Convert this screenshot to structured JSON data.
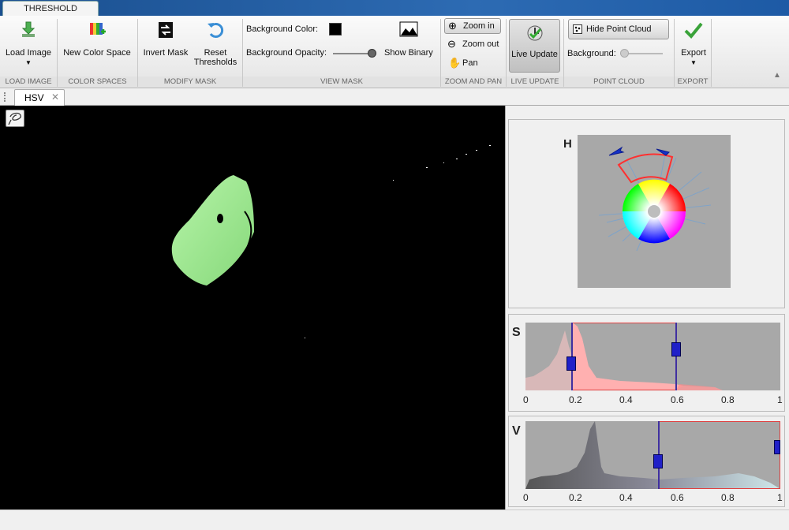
{
  "window": {
    "tab": "THRESHOLD"
  },
  "toolstrip": {
    "load_image": "Load Image",
    "new_color_space": "New Color Space",
    "invert_mask": "Invert Mask",
    "reset_thresholds_1": "Reset",
    "reset_thresholds_2": "Thresholds",
    "background_color_label": "Background Color:",
    "background_color": "#000000",
    "background_opacity_label": "Background Opacity:",
    "show_binary": "Show Binary",
    "zoom_in": "Zoom in",
    "zoom_out": "Zoom out",
    "pan": "Pan",
    "live_update": "Live Update",
    "hide_point_cloud": "Hide Point Cloud",
    "background_label": "Background:",
    "export": "Export",
    "groups": [
      "LOAD IMAGE",
      "COLOR SPACES",
      "MODIFY MASK",
      "VIEW MASK",
      "ZOOM AND PAN",
      "LIVE UPDATE",
      "POINT CLOUD",
      "EXPORT"
    ]
  },
  "doc_tabs": [
    {
      "label": "HSV"
    }
  ],
  "panels": {
    "h": {
      "label": "H"
    },
    "s": {
      "label": "S",
      "range": [
        0.18,
        0.59
      ]
    },
    "v": {
      "label": "V",
      "range": [
        0.52,
        1.0
      ]
    },
    "ticks": [
      "0",
      "0.2",
      "0.4",
      "0.6",
      "0.8",
      "1"
    ]
  },
  "colors": {
    "accent": "#0000cc",
    "selection": "#ff4444",
    "mask": "#99ee99"
  }
}
